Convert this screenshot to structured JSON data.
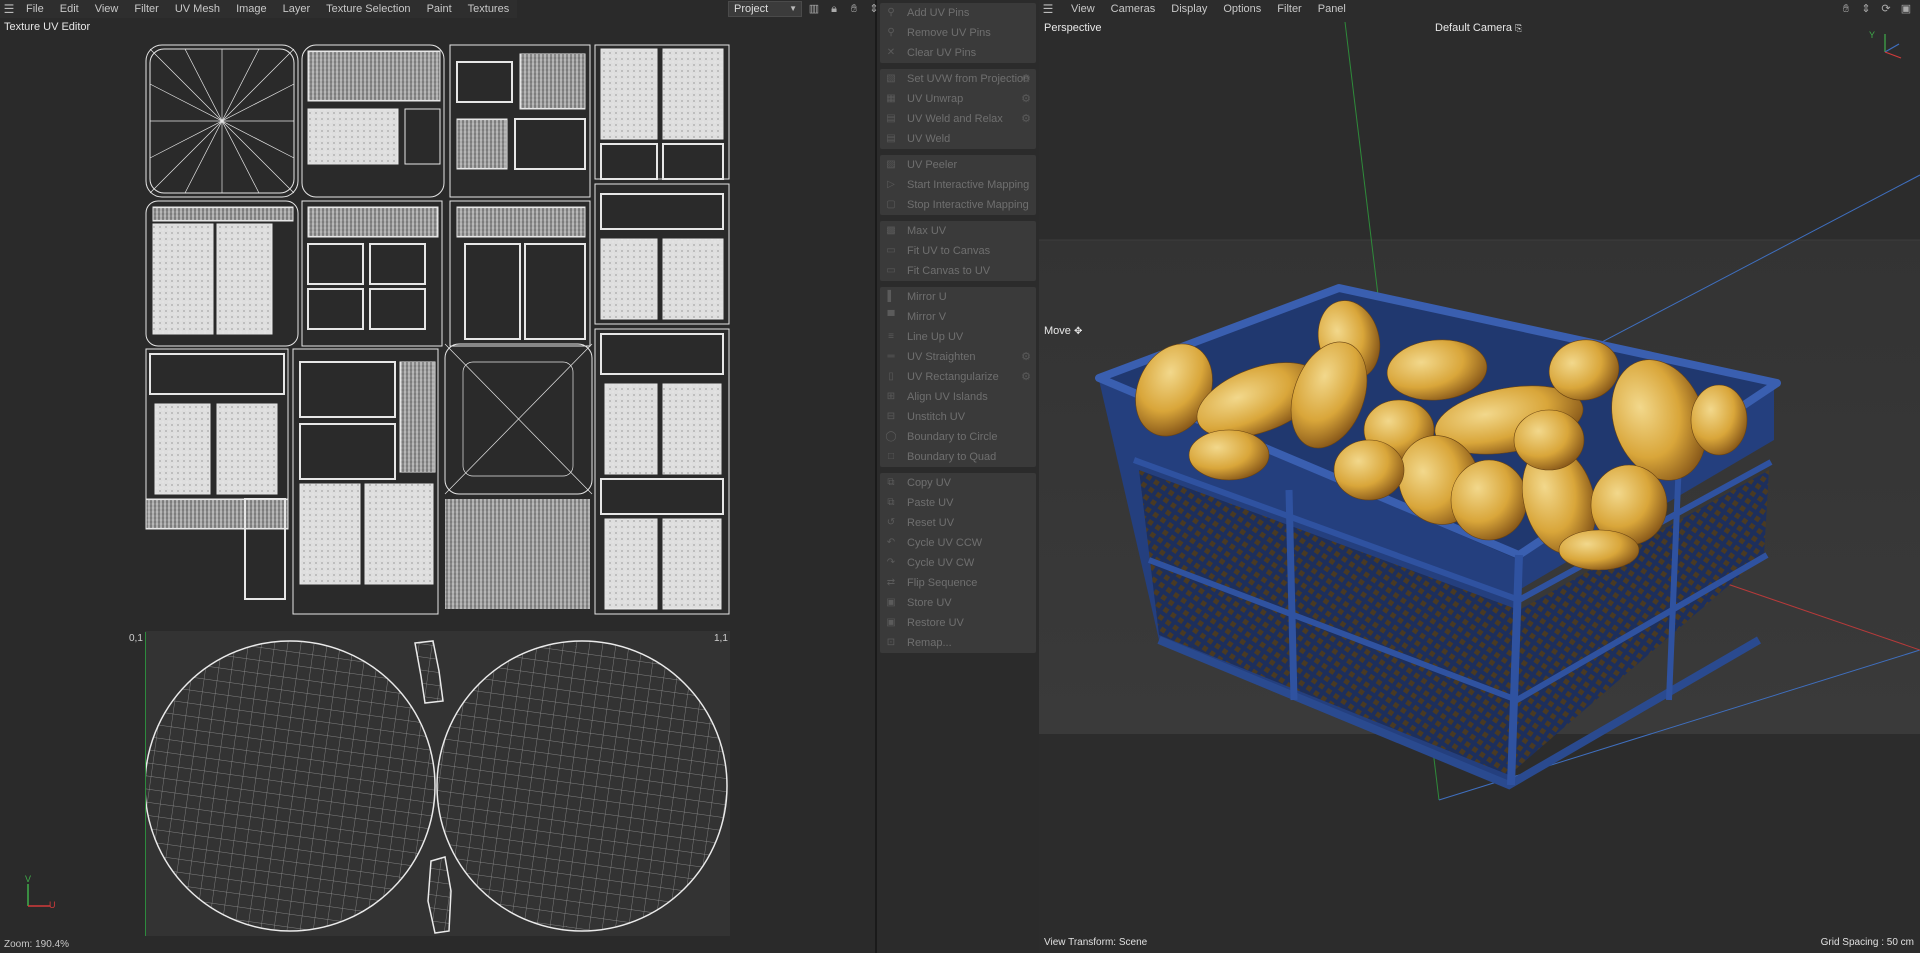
{
  "uv_editor": {
    "menu": [
      "File",
      "Edit",
      "View",
      "Filter",
      "UV Mesh",
      "Image",
      "Layer",
      "Texture Selection",
      "Paint",
      "Textures"
    ],
    "project_value": "Project",
    "title": "Texture UV Editor",
    "corner_tl": "0,1",
    "corner_tr": "1,1",
    "axis_v": "V",
    "axis_u": "U",
    "zoom_status": "Zoom: 190.4%"
  },
  "commands": {
    "groups": [
      [
        {
          "label": "Add UV Pins",
          "icon": "pin-icon",
          "gear": false
        },
        {
          "label": "Remove UV Pins",
          "icon": "pin-icon",
          "gear": false
        },
        {
          "label": "Clear UV Pins",
          "icon": "x-icon",
          "gear": false
        }
      ],
      [
        {
          "label": "Set UVW from Projection",
          "icon": "projection-icon",
          "gear": true
        },
        {
          "label": "UV Unwrap",
          "icon": "unwrap-icon",
          "gear": true
        },
        {
          "label": "UV Weld and Relax",
          "icon": "weld-icon",
          "gear": true
        },
        {
          "label": "UV Weld",
          "icon": "weld-icon",
          "gear": false
        }
      ],
      [
        {
          "label": "UV Peeler",
          "icon": "peeler-icon",
          "gear": false
        },
        {
          "label": "Start Interactive Mapping",
          "icon": "play-icon",
          "gear": false
        },
        {
          "label": "Stop Interactive Mapping",
          "icon": "stop-icon",
          "gear": false
        }
      ],
      [
        {
          "label": "Max UV",
          "icon": "max-icon",
          "gear": false
        },
        {
          "label": "Fit UV to Canvas",
          "icon": "fit-icon",
          "gear": false
        },
        {
          "label": "Fit Canvas to UV",
          "icon": "fit-icon",
          "gear": false
        }
      ],
      [
        {
          "label": "Mirror U",
          "icon": "mirror-u-icon",
          "gear": false
        },
        {
          "label": "Mirror V",
          "icon": "mirror-v-icon",
          "gear": false
        },
        {
          "label": "Line Up UV",
          "icon": "lineup-icon",
          "gear": false
        },
        {
          "label": "UV Straighten",
          "icon": "straighten-icon",
          "gear": true
        },
        {
          "label": "UV Rectangularize",
          "icon": "rect-icon",
          "gear": true
        },
        {
          "label": "Align UV Islands",
          "icon": "align-icon",
          "gear": false
        },
        {
          "label": "Unstitch UV",
          "icon": "unstitch-icon",
          "gear": false
        },
        {
          "label": "Boundary to Circle",
          "icon": "circle-icon",
          "gear": false
        },
        {
          "label": "Boundary to Quad",
          "icon": "quad-icon",
          "gear": false
        }
      ],
      [
        {
          "label": "Copy UV",
          "icon": "copy-icon",
          "gear": false
        },
        {
          "label": "Paste UV",
          "icon": "paste-icon",
          "gear": false
        },
        {
          "label": "Reset UV",
          "icon": "reset-icon",
          "gear": false
        },
        {
          "label": "Cycle UV CCW",
          "icon": "ccw-icon",
          "gear": false
        },
        {
          "label": "Cycle UV CW",
          "icon": "cw-icon",
          "gear": false
        },
        {
          "label": "Flip Sequence",
          "icon": "flip-icon",
          "gear": false
        },
        {
          "label": "Store UV",
          "icon": "store-icon",
          "gear": false
        },
        {
          "label": "Restore UV",
          "icon": "restore-icon",
          "gear": false
        },
        {
          "label": "Remap...",
          "icon": "remap-icon",
          "gear": false
        }
      ]
    ]
  },
  "viewport": {
    "menu": [
      "View",
      "Cameras",
      "Display",
      "Options",
      "Filter",
      "Panel"
    ],
    "projection": "Perspective",
    "camera": "Default Camera",
    "tool": "Move",
    "view_transform": "View Transform: Scene",
    "grid_spacing": "Grid Spacing : 50 cm",
    "colors": {
      "crate": "#2a4a8f",
      "fruit": "#d9a63a",
      "grid": "#3a3a3a"
    }
  }
}
